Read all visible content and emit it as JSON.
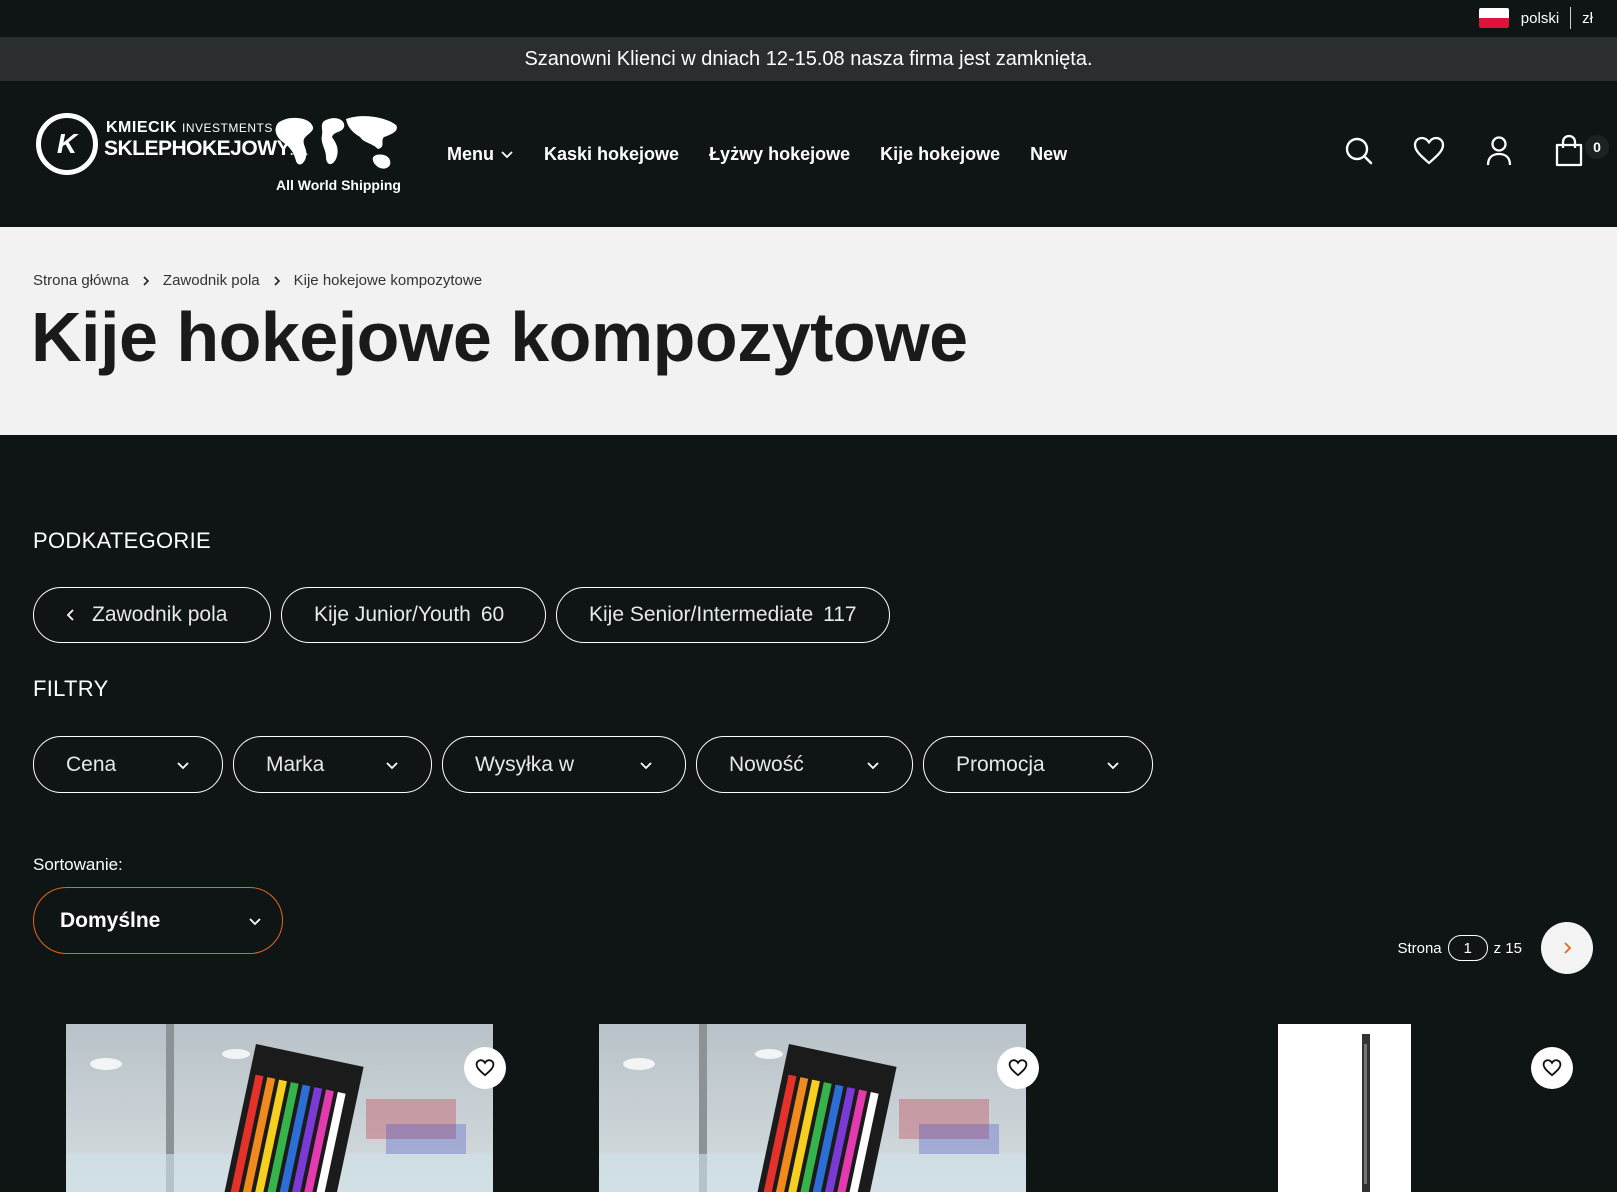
{
  "topbar": {
    "language": "polski",
    "currency": "zł"
  },
  "announcement": "Szanowni Klienci w dniach 12-15.08 nasza firma jest zamknięta.",
  "logo": {
    "line1_bold": "KMIECIK",
    "line1_small": "INVESTMENTS",
    "line2_main": "SKLEPHOKEJOWY",
    "line2_small": ".PL",
    "line3": "All World Shipping",
    "mark": "K"
  },
  "nav": {
    "items": [
      {
        "label": "Menu"
      },
      {
        "label": "Kaski hokejowe"
      },
      {
        "label": "Łyżwy hokejowe"
      },
      {
        "label": "Kije hokejowe"
      },
      {
        "label": "New"
      }
    ]
  },
  "header_icons": {
    "search": "search-icon",
    "wishlist": "heart-icon",
    "account": "user-icon",
    "cart": "cart-icon",
    "cart_count": "0"
  },
  "breadcrumb": [
    "Strona główna",
    "Zawodnik pola",
    "Kije hokejowe kompozytowe"
  ],
  "page_title": "Kije hokejowe kompozytowe",
  "subcategories": {
    "title": "PODKATEGORIE",
    "back": {
      "label": "Zawodnik pola"
    },
    "items": [
      {
        "label": "Kije Junior/Youth",
        "count": "60"
      },
      {
        "label": "Kije Senior/Intermediate",
        "count": "117"
      }
    ]
  },
  "filters": {
    "title": "FILTRY",
    "items": [
      {
        "label": "Cena"
      },
      {
        "label": "Marka"
      },
      {
        "label": "Wysyłka w"
      },
      {
        "label": "Nowość"
      },
      {
        "label": "Promocja"
      }
    ]
  },
  "sorting": {
    "label": "Sortowanie:",
    "value": "Domyślne"
  },
  "pagination": {
    "prefix": "Strona",
    "current": "1",
    "suffix": "z 15"
  },
  "colors": {
    "background": "#0f1414",
    "announce_bg": "#2b2e2e",
    "hero_bg": "#f2f2f2",
    "accent": "#e0691a"
  }
}
